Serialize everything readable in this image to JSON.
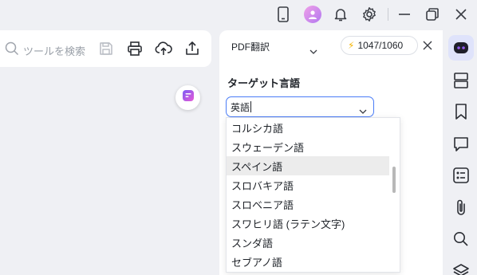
{
  "titlebar": {
    "icons": [
      "phone-icon",
      "avatar",
      "bell-icon",
      "gear-icon",
      "minimize-icon",
      "restore-icon",
      "close-icon"
    ]
  },
  "toolbar": {
    "search_placeholder": "ツールを検索"
  },
  "panel": {
    "mode": "PDF翻訳",
    "credits": "1047/1060",
    "target_label": "ターゲット言語",
    "selected_language": "英語"
  },
  "dropdown": {
    "options": [
      "コルシカ語",
      "スウェーデン語",
      "スペイン語",
      "スロバキア語",
      "スロベニア語",
      "スワヒリ語 (ラテン文字)",
      "スンダ語",
      "セブアノ語"
    ],
    "highlighted_index": 2
  },
  "colors": {
    "accent": "#4a7cf7",
    "hover": "#ececec",
    "credit_bolt": "#f5b400",
    "active_sidebar": "#dfe3fb"
  }
}
